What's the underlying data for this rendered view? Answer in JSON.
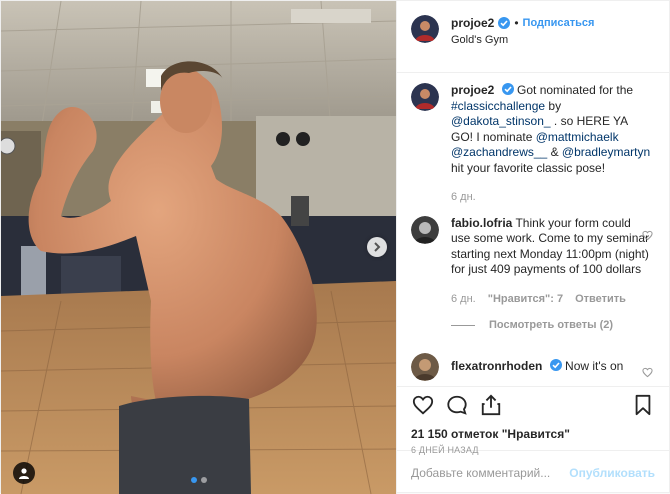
{
  "post": {
    "username": "projoe2",
    "separator": "•",
    "follow_label": "Подписаться",
    "location": "Gold's Gym",
    "carousel_dot_count": 2,
    "carousel_active_index": 0
  },
  "caption": {
    "username": "projoe2",
    "parts": [
      {
        "text": "Got nominated for the ",
        "kind": "text"
      },
      {
        "text": "#classicchallenge",
        "kind": "link"
      },
      {
        "text": " by ",
        "kind": "text"
      },
      {
        "text": "@dakota_stinson_",
        "kind": "link"
      },
      {
        "text": " . so HERE YA GO! I nominate ",
        "kind": "text"
      },
      {
        "text": "@mattmichaelk",
        "kind": "link"
      },
      {
        "text": " ",
        "kind": "text"
      },
      {
        "text": "@zachandrews__",
        "kind": "link"
      },
      {
        "text": " & ",
        "kind": "text"
      },
      {
        "text": "@bradleymartyn",
        "kind": "link"
      },
      {
        "text": " hit your favorite classic pose!",
        "kind": "text"
      }
    ],
    "time": "6 дн."
  },
  "comments": [
    {
      "username": "fabio.lofria",
      "text": "Think your form could use some work. Come to my seminar starting next Monday 11:00pm (night) for just 409 payments of 100 dollars",
      "time": "6 дн.",
      "likes": "\"Нравится\": 7",
      "reply": "Ответить",
      "view_replies": "Посмотреть ответы (2)"
    },
    {
      "username": "flexatronrhoden",
      "text": "Now it's on"
    }
  ],
  "likes_text": "21 150 отметок \"Нравится\"",
  "posted_ago": "6 ДНЕЙ НАЗАД",
  "add_comment": {
    "placeholder": "Добавьте комментарий...",
    "publish_label": "Опубликовать"
  },
  "colors": {
    "accent": "#3897f0",
    "verified": "#3897f0",
    "link": "#003569",
    "muted": "#999999",
    "publish_disabled": "#b2dffc"
  },
  "icons": {
    "like": "heart-icon",
    "comment": "speech-bubble-icon",
    "share": "share-arrow-icon",
    "save": "bookmark-icon",
    "next": "chevron-right-icon",
    "tag": "person-tag-icon"
  }
}
